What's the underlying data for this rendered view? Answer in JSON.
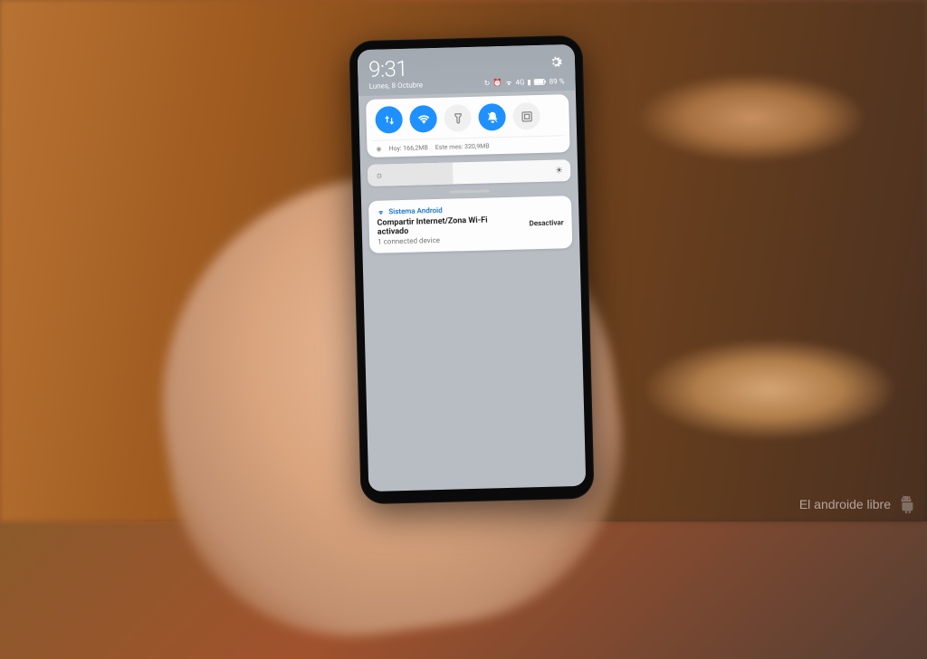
{
  "status": {
    "time": "9:31",
    "date": "Lunes, 8 Octubre",
    "network_label": "4G",
    "battery_label": "89 %",
    "icons": [
      "sync",
      "alarm",
      "wifi",
      "signal",
      "battery"
    ]
  },
  "settings_icon": "gear-icon",
  "quick_settings": {
    "toggles": [
      {
        "name": "data-toggle",
        "icon": "data-arrows",
        "active": true
      },
      {
        "name": "wifi-toggle",
        "icon": "wifi",
        "active": true
      },
      {
        "name": "flashlight-toggle",
        "icon": "flashlight",
        "active": false
      },
      {
        "name": "dnd-toggle",
        "icon": "bell-off",
        "active": true
      },
      {
        "name": "screenshot-toggle",
        "icon": "screenshot",
        "active": false
      }
    ],
    "data_usage": {
      "today_label": "Hoy:",
      "today_value": "166,2MB",
      "month_label": "Este mes:",
      "month_value": "320,9MB"
    }
  },
  "brightness": {
    "level_percent": 42
  },
  "notification": {
    "app_name": "Sistema Android",
    "title": "Compartir Internet/Zona Wi-Fi activado",
    "subtitle": "1 connected device",
    "action_label": "Desactivar"
  },
  "watermark": "El androide libre"
}
